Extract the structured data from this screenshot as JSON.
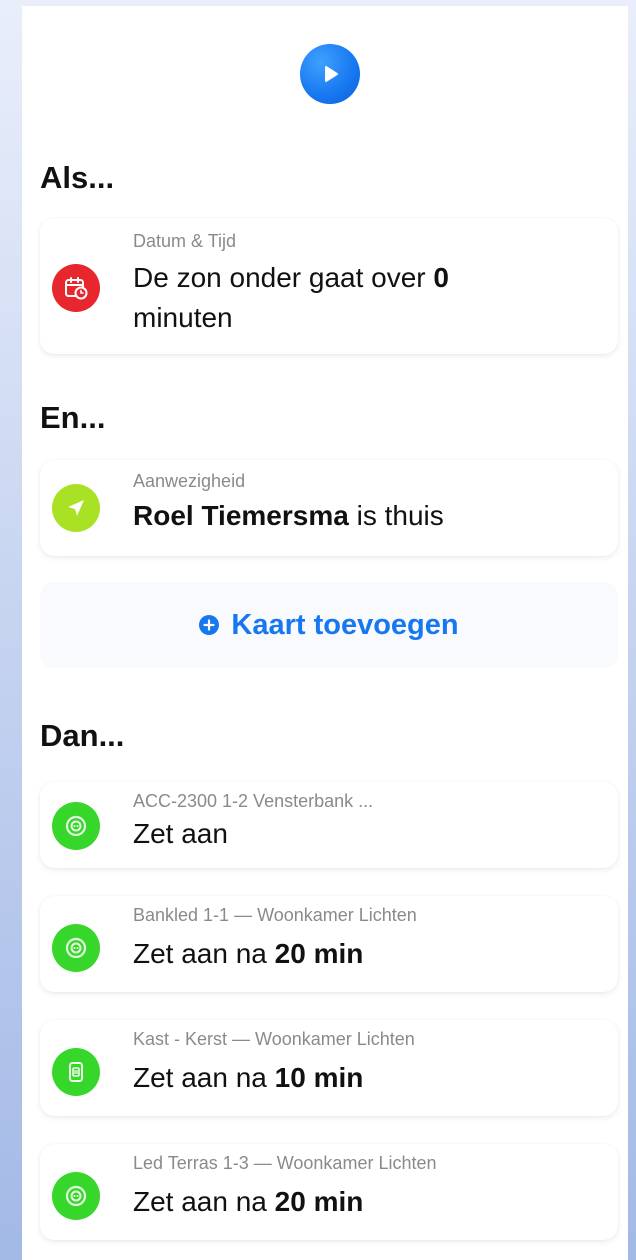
{
  "header": {
    "play_icon": "play-icon",
    "accent": "#1677f0"
  },
  "if_section": {
    "title": "Als...",
    "card": {
      "subtitle": "Datum & Tijd",
      "text_part1": "De zon onder gaat over",
      "text_value": "0",
      "text_part2": "minuten",
      "icon": "calendar-clock-icon",
      "icon_color": "#e8262d"
    }
  },
  "and_section": {
    "title": "En...",
    "card": {
      "subtitle": "Aanwezigheid",
      "name": "Roel Tiemersma",
      "text": "is thuis",
      "icon": "location-arrow-icon",
      "icon_color": "#a9e224"
    },
    "add_card_label": "Kaart toevoegen"
  },
  "then_section": {
    "title": "Dan...",
    "cards": [
      {
        "subtitle": "ACC-2300 1-2 Vensterbank ...",
        "action": "Zet aan",
        "suffix": "",
        "delay": "",
        "icon": "socket-icon",
        "icon_color": "#36d62a"
      },
      {
        "subtitle": "Bankled 1-1 — Woonkamer Lichten",
        "action": "Zet aan",
        "suffix": "na",
        "delay": "20 min",
        "icon": "socket-icon",
        "icon_color": "#36d62a"
      },
      {
        "subtitle": "Kast - Kerst — Woonkamer Lichten",
        "action": "Zet aan",
        "suffix": "na",
        "delay": "10 min",
        "icon": "plug-icon",
        "icon_color": "#36d62a"
      },
      {
        "subtitle": "Led Terras 1-3 — Woonkamer Lichten",
        "action": "Zet aan",
        "suffix": "na",
        "delay": "20 min",
        "icon": "socket-icon",
        "icon_color": "#36d62a"
      }
    ]
  }
}
